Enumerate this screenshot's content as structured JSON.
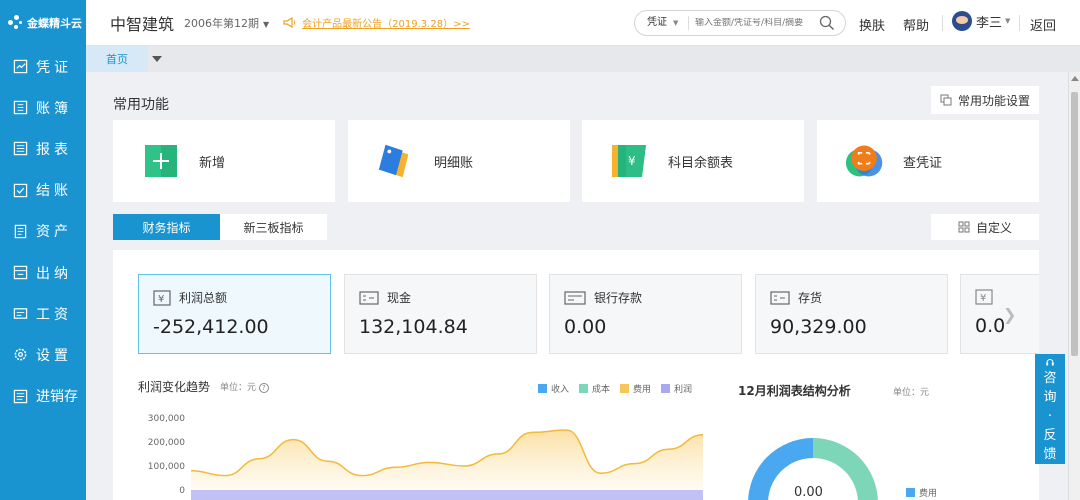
{
  "sidebar": {
    "logo": "金蝶精斗云",
    "items": [
      {
        "label": "凭证",
        "icon": "voucher-icon"
      },
      {
        "label": "账簿",
        "icon": "ledger-icon"
      },
      {
        "label": "报表",
        "icon": "report-icon"
      },
      {
        "label": "结账",
        "icon": "closing-icon"
      },
      {
        "label": "资产",
        "icon": "asset-icon"
      },
      {
        "label": "出纳",
        "icon": "cashier-icon"
      },
      {
        "label": "工资",
        "icon": "salary-icon"
      },
      {
        "label": "设置",
        "icon": "settings-icon"
      },
      {
        "label": "进销存",
        "icon": "inventory-icon"
      }
    ]
  },
  "header": {
    "company": "中智建筑",
    "period": "2006年第12期",
    "notice": "会计产品最新公告（2019.3.28）>>",
    "search": {
      "type": "凭证",
      "placeholder": "输入金额/凭证号/科目/摘要"
    },
    "skin": "换肤",
    "help": "帮助",
    "user": "李三",
    "back": "返回"
  },
  "tabs": {
    "home": "首页"
  },
  "common": {
    "title": "常用功能",
    "settings": "常用功能设置",
    "functions": [
      {
        "label": "新增",
        "icon": "add-icon"
      },
      {
        "label": "明细账",
        "icon": "detail-ledger-icon"
      },
      {
        "label": "科目余额表",
        "icon": "balance-sheet-icon"
      },
      {
        "label": "查凭证",
        "icon": "search-voucher-icon"
      }
    ]
  },
  "indicator_tabs": {
    "finance": "财务指标",
    "neeq": "新三板指标",
    "custom": "自定义"
  },
  "kpis": [
    {
      "label": "利润总额",
      "value": "-252,412.00"
    },
    {
      "label": "现金",
      "value": "132,104.84"
    },
    {
      "label": "银行存款",
      "value": "0.00"
    },
    {
      "label": "存货",
      "value": "90,329.00"
    },
    {
      "label": "",
      "value": "0.0"
    }
  ],
  "trend": {
    "title": "利润变化趋势",
    "unit": "单位：元",
    "legend": [
      {
        "name": "收入",
        "color": "#4aa8f0"
      },
      {
        "name": "成本",
        "color": "#7ed6b8"
      },
      {
        "name": "费用",
        "color": "#f7c65a"
      },
      {
        "name": "利润",
        "color": "#a9a8f0"
      }
    ]
  },
  "chart_data": {
    "type": "area",
    "yticks": [
      "300,000",
      "200,000",
      "100,000",
      "0"
    ],
    "ylim": [
      0,
      300000
    ],
    "series": [
      {
        "name": "费用",
        "values": [
          80000,
          60000,
          130000,
          210000,
          120000,
          60000,
          95000,
          115000,
          100000,
          150000,
          240000,
          250000,
          70000,
          110000,
          170000,
          230000
        ]
      }
    ]
  },
  "structure": {
    "title": "12月利润表结构分析",
    "unit": "单位：元",
    "center_value": "0.00",
    "legend": "费用",
    "colors": {
      "blue": "#4aa8f0",
      "green": "#7ed6b8"
    }
  },
  "feedback": [
    "咨",
    "询",
    "·",
    "反",
    "馈"
  ]
}
